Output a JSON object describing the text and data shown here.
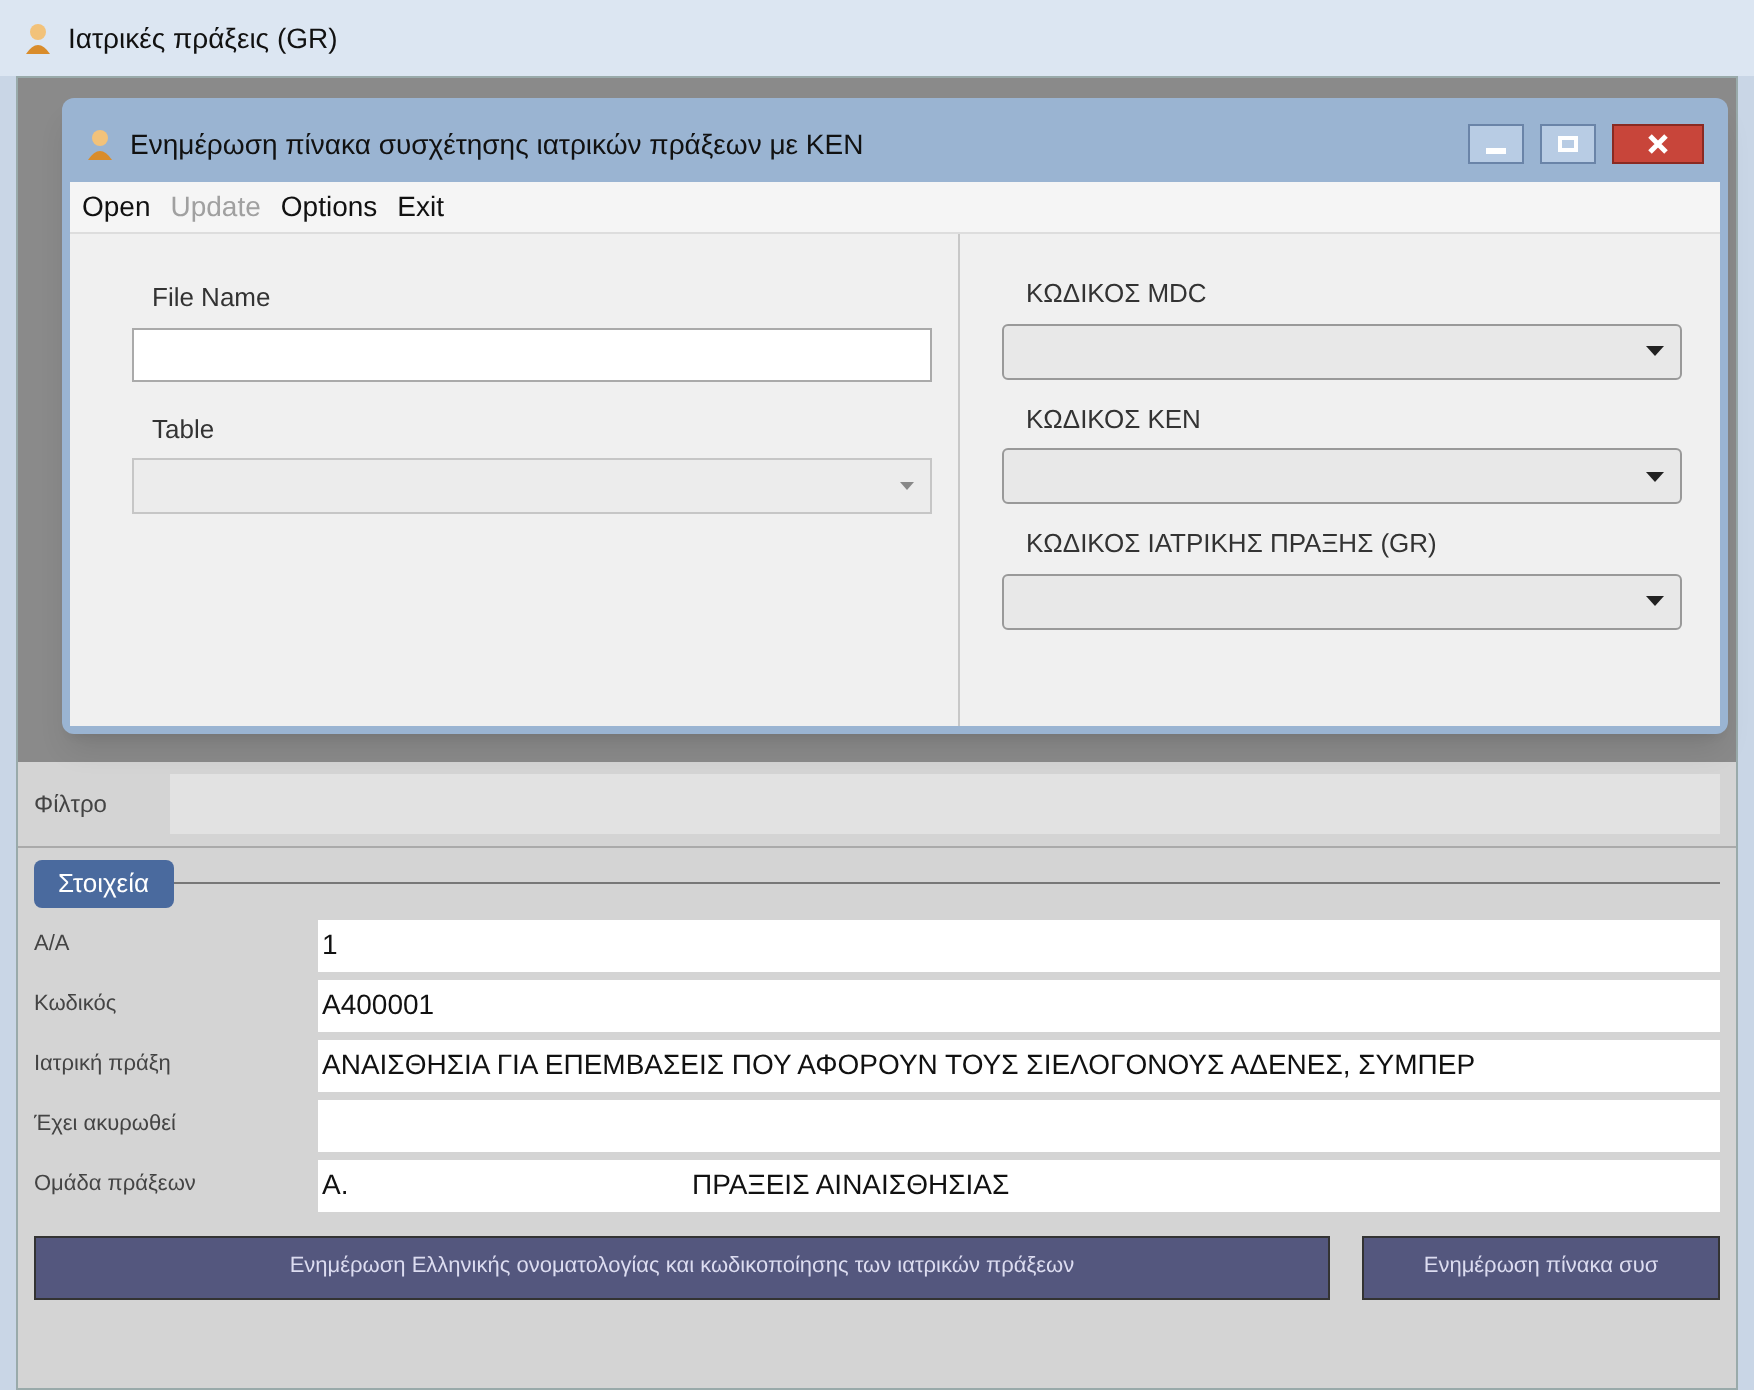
{
  "window": {
    "title": "Ιατρικές πράξεις (GR)"
  },
  "dialog": {
    "title": "Ενημέρωση πίνακα συσχέτησης ιατρικών πράξεων με ΚΕΝ",
    "menu": [
      {
        "label": "Open",
        "disabled": false
      },
      {
        "label": "Update",
        "disabled": true
      },
      {
        "label": "Options",
        "disabled": false
      },
      {
        "label": "Exit",
        "disabled": false
      }
    ],
    "left_fields": [
      {
        "kind": "text",
        "label": "File Name"
      },
      {
        "kind": "select",
        "label": "Table"
      }
    ],
    "right_fields": [
      {
        "label": "ΚΩΔΙΚΟΣ MDC"
      },
      {
        "label": "ΚΩΔΙΚΟΣ ΚΕΝ"
      },
      {
        "label": "ΚΩΔΙΚΟΣ ΙΑΤΡΙΚΗΣ ΠΡΑΞΗΣ (GR)"
      }
    ]
  },
  "filter": {
    "label": "Φίλτρο"
  },
  "details": {
    "title": "Στοιχεία",
    "rows": [
      {
        "label": "Α/Α",
        "values": [
          "1"
        ]
      },
      {
        "label": "Κωδικός",
        "values": [
          "A400001"
        ]
      },
      {
        "label": "Ιατρική πράξη",
        "values": [
          "ΑΝΑΙΣΘΗΣΙΑ ΓΙΑ ΕΠΕΜΒΑΣΕΙΣ ΠΟΥ ΑΦΟΡΟΥΝ ΤΟΥΣ ΣΙΕΛΟΓΟΝΟΥΣ ΑΔΕΝΕΣ, ΣΥΜΠΕΡ"
        ]
      },
      {
        "label": "Έχει ακυρωθεί",
        "values": []
      },
      {
        "label": "Ομάδα πράξεων",
        "values": [
          "Α.",
          "ΠΡΑΞΕΙΣ ΑΙΝΑΙΣΘΗΣΙΑΣ"
        ]
      }
    ]
  },
  "buttons": [
    "Ενημέρωση Ελληνικής ονοματολογίας και κωδικοποίησης των ιατρικών πράξεων",
    "Ενημέρωση πίνακα συσ"
  ]
}
